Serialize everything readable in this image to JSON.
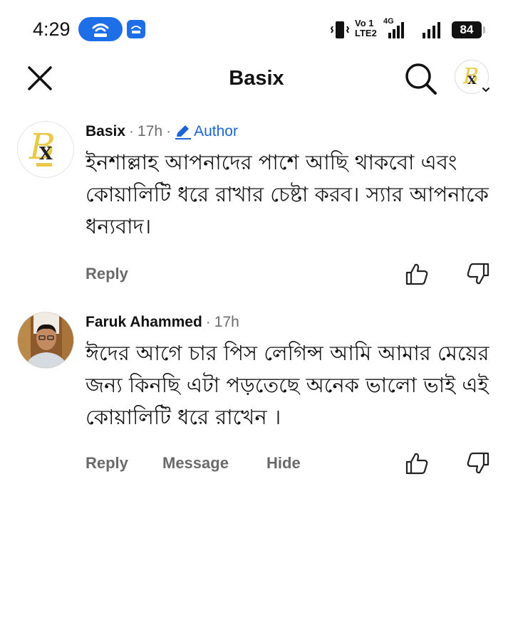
{
  "status_bar": {
    "time": "4:29",
    "volte_top": "Vo 1",
    "volte_bottom": "LTE2",
    "network": "4G",
    "battery": "84",
    "icons": [
      "hotspot-icon",
      "sync-icon",
      "vibrate-icon",
      "signal-icon",
      "battery-icon"
    ]
  },
  "header": {
    "title": "Basix",
    "close_icon": "close-icon",
    "search_icon": "search-icon"
  },
  "comments": [
    {
      "name": "Basix",
      "time": "17h",
      "author_label": "Author",
      "text": "ইনশাল্লাহ আপনাদের পাশে আছি থাকবো এবং কোয়ালিটি ধরে রাখার চেষ্টা করব। স্যার আপনাকে ধন্যবাদ।",
      "actions": [
        "Reply"
      ]
    },
    {
      "name": "Faruk Ahammed",
      "time": "17h",
      "text": "ঈদের আগে চার পিস লেগিন্স আমি আমার মেয়ের জন্য কিনছি এটা পড়তেছে অনেক ভালো ভাই এই কোয়ালিটি ধরে রাখেন ।",
      "actions": [
        "Reply",
        "Message",
        "Hide"
      ]
    }
  ],
  "colors": {
    "accent": "#1e6ee8",
    "author": "#1b64d6",
    "action_text": "#6a6a6a"
  }
}
